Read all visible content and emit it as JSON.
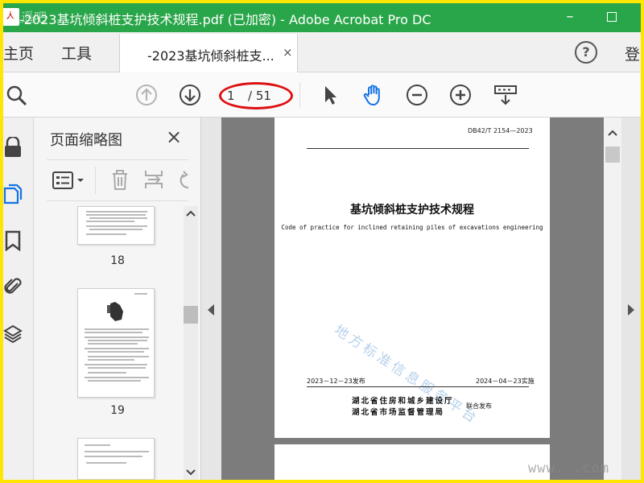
{
  "window": {
    "watermark": "逍遥吧",
    "title": "-2023基坑倾斜桩支护技术规程.pdf  (已加密)  - Adobe Acrobat Pro DC",
    "minimize": "–",
    "maximize": "□"
  },
  "tabs": {
    "home": "主页",
    "tools": "工具",
    "doc_tab": "-2023基坑倾斜桩支...",
    "doc_tab_close": "×",
    "help": "?",
    "login_partial": "登"
  },
  "toolbar": {
    "page_current": "1",
    "page_total": "/ 51",
    "highlight_color": "#dd1111"
  },
  "thumbnails": {
    "title": "页面缩略图",
    "close": "×",
    "items": [
      {
        "label": "18"
      },
      {
        "label": "19"
      }
    ]
  },
  "document": {
    "standard_no": "DB42/T 2154—2023",
    "title_cn": "基坑倾斜桩支护技术规程",
    "title_en": "Code of practice for inclined retaining piles of excavations engineering",
    "watermark": "地方标准信息服务平台",
    "issue_date": "2023－12－23发布",
    "implement_date": "2024－04－23实施",
    "issuer_1": "湖北省住房和城乡建设厅",
    "issuer_2": "湖北省市场监督管理局",
    "joint": "联合发布"
  },
  "site_watermark": "www.     .com",
  "colors": {
    "titlebar": "#2aa64a",
    "accent_blue": "#1473e6",
    "frame": "#ffe600"
  }
}
